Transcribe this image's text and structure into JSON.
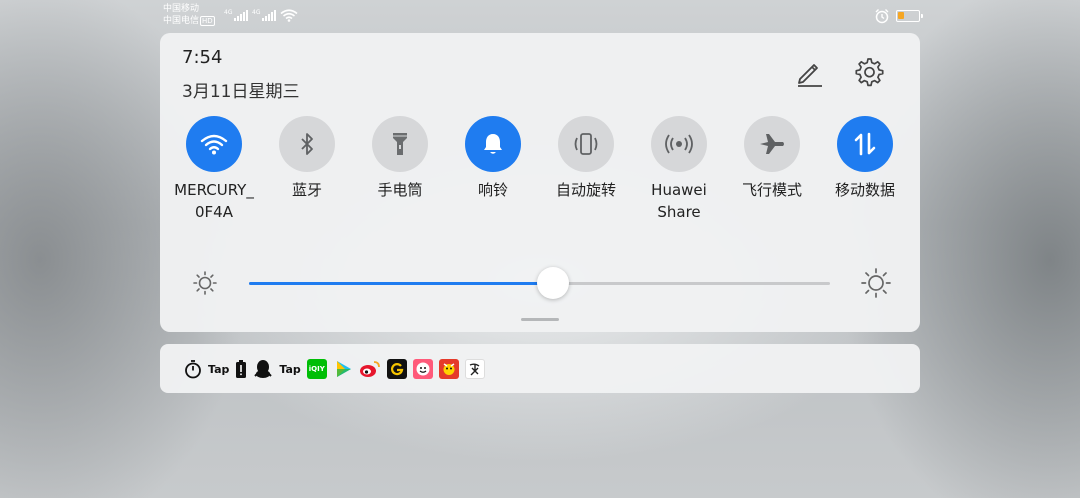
{
  "status_bar": {
    "carrier1": "中国移动",
    "carrier2": "中国电信",
    "hd_badge": "HD",
    "net1": "4G",
    "net2": "4G",
    "battery_level": 0.3,
    "battery_color": "#f5a623",
    "alarm_icon": "alarm-clock-icon"
  },
  "header": {
    "time": "7:54",
    "date": "3月11日星期三",
    "edit_icon": "pencil-edit-icon",
    "settings_icon": "gear-icon"
  },
  "tiles": [
    {
      "label": "MERCURY_\n0F4A",
      "icon": "wifi-icon",
      "active": true
    },
    {
      "label": "蓝牙",
      "icon": "bluetooth-icon",
      "active": false
    },
    {
      "label": "手电筒",
      "icon": "flashlight-icon",
      "active": false
    },
    {
      "label": "响铃",
      "icon": "bell-icon",
      "active": true
    },
    {
      "label": "自动旋转",
      "icon": "auto-rotate-icon",
      "active": false
    },
    {
      "label": "Huawei\nShare",
      "icon": "huawei-share-icon",
      "active": false
    },
    {
      "label": "飞行模式",
      "icon": "airplane-icon",
      "active": false
    },
    {
      "label": "移动数据",
      "icon": "mobile-data-icon",
      "active": true
    }
  ],
  "brightness": {
    "level": 0.523,
    "low_icon": "brightness-low-icon",
    "high_icon": "brightness-high-icon"
  },
  "accent_color": "#1f7cf0",
  "notifications": {
    "tap_label_1": "Tap",
    "tap_label_2": "Tap",
    "iqiyi_text": "iQIY",
    "apps": [
      "stopwatch-icon",
      "taptap-icon",
      "battery-alert-icon",
      "qq-icon",
      "taptap-icon",
      "iqiyi-icon",
      "play-icon",
      "weibo-icon",
      "g-app-icon",
      "meme-app-icon",
      "news-app-icon",
      "calligraphy-app-icon"
    ]
  }
}
